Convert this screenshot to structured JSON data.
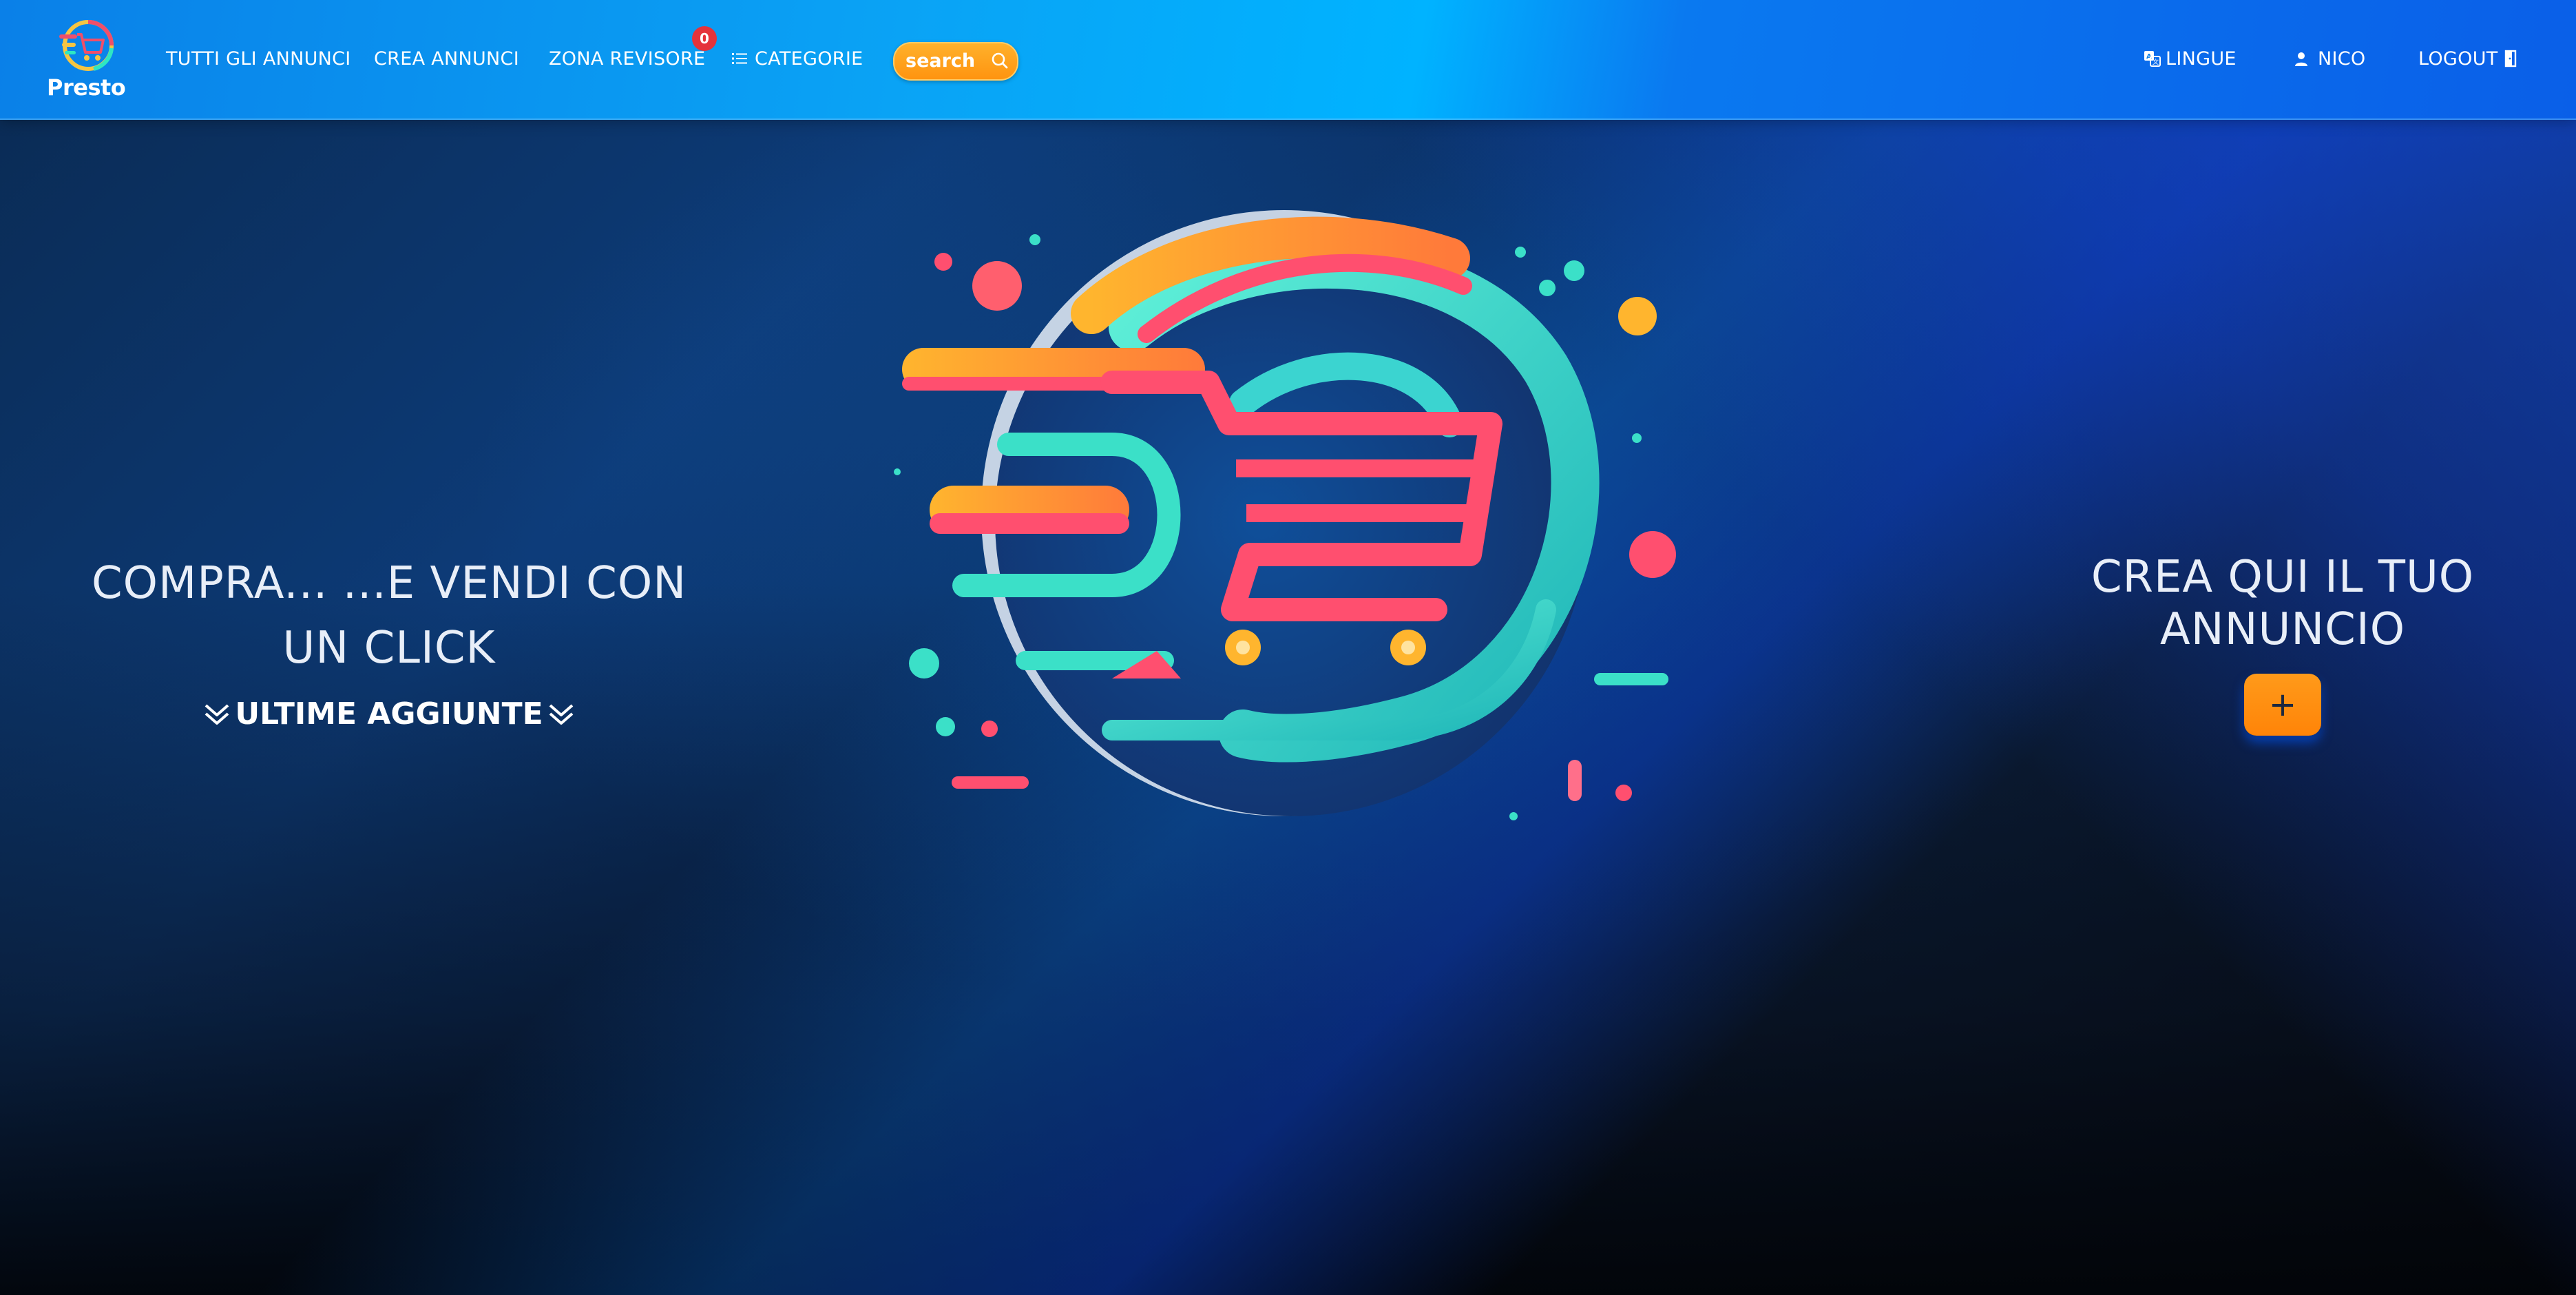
{
  "brand": {
    "name": "Presto"
  },
  "nav": {
    "all_ads": "TUTTI GLI ANNUNCI",
    "create_ad": "CREA ANNUNCI",
    "reviewer_zone": "ZONA REVISORE",
    "reviewer_badge": "0",
    "categories": "CATEGORIE",
    "search_placeholder": "search",
    "languages": "LINGUE",
    "user": "NICO",
    "logout": "LOGOUT"
  },
  "hero": {
    "title_line1": "COMPRA... ...E VENDI CON",
    "title_line2": "UN CLICK",
    "latest": "ULTIME AGGIUNTE",
    "cta_line1": "CREA QUI IL TUO",
    "cta_line2": "ANNUNCIO",
    "add_label": "+"
  },
  "colors": {
    "navbar": "#0aa3f5",
    "accent": "#ff9410",
    "badge": "#e5333b"
  },
  "icons": {
    "categories": "list-icon",
    "search": "magnifier-icon",
    "languages": "translate-icon",
    "user": "person-icon",
    "logout": "door-icon",
    "latest": "double-chevron-down-icon"
  }
}
